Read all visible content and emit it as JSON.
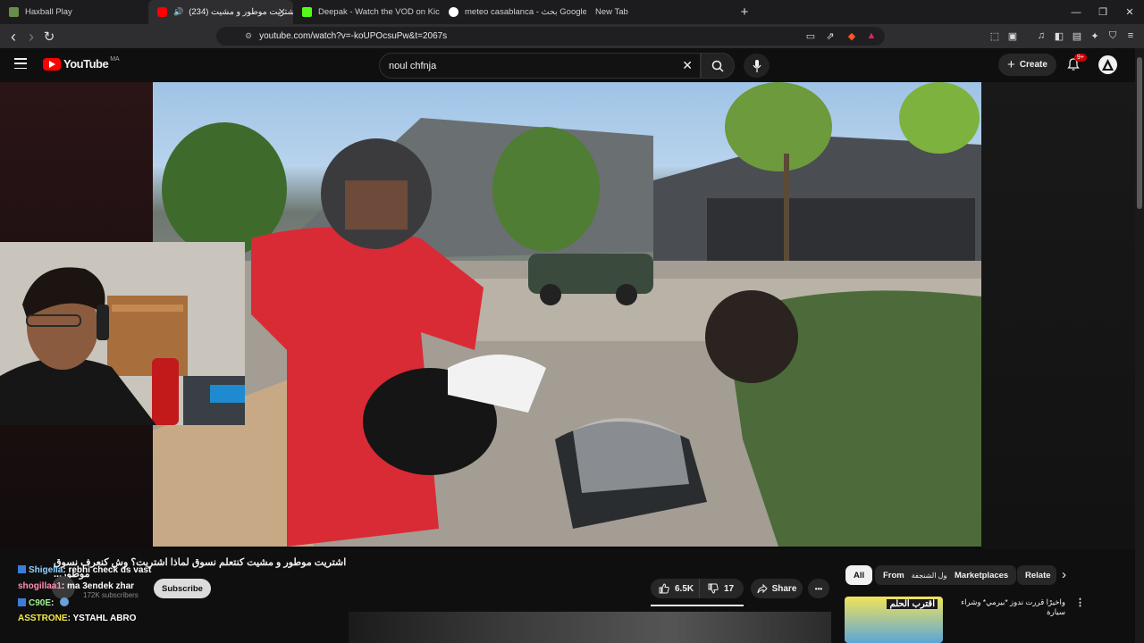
{
  "tabs": [
    {
      "title": "Haxball Play",
      "favicon_color": "#6a8c4a",
      "active": false
    },
    {
      "title": "(234) اشتريت موطور و مشيت",
      "favicon_color": "#ff0000",
      "active": true,
      "close": "✕"
    },
    {
      "title": "Deepak - Watch the VOD on Kick",
      "favicon_color": "#53fc18",
      "active": false
    },
    {
      "title": "meteo casablanca - بحث Google",
      "favicon_color": "#4285f4",
      "active": false
    },
    {
      "title": "New Tab",
      "favicon_color": "#2e2e31",
      "active": false
    }
  ],
  "browser": {
    "new_tab": "+",
    "minimize": "—",
    "restore": "❐",
    "close": "✕",
    "back": "‹",
    "forward": "›",
    "reload": "↻",
    "bookmark": "☆",
    "url": "youtube.com/watch?v=-koUPOcsuPw&t=2067s"
  },
  "youtube": {
    "logo_text": "YouTube",
    "region": "MA",
    "search_value": "noul chfnja",
    "clear": "✕",
    "create_label": "Create",
    "notifications_badge": "9+"
  },
  "video": {
    "title": "اشتريت موطور و مشيت كنتعلم نسوق لماذا اشتريت؟ وش كنعرف نسوق موطور...",
    "channel_subscribers": "172K subscribers",
    "subscribe_label": "Subscribe",
    "likes": "6.5K",
    "dislikes": "17",
    "share_label": "Share",
    "more": "•••"
  },
  "chat": [
    {
      "user": "Shigella",
      "message": ": rebhi check ds vast",
      "color": "#8fd3ff",
      "icon": true
    },
    {
      "user": "shogillaa1",
      "message": ": ma 3endek zhar",
      "color": "#ff8fb1",
      "icon": false
    },
    {
      "user": "C90E",
      "message": ":",
      "color": "#9ff58f",
      "icon": true
    },
    {
      "user": "ASSTRONE",
      "message": ": YSTAHL ABRO",
      "color": "#f5e84a",
      "icon": false
    }
  ],
  "related": {
    "chips": [
      "All",
      "From",
      "مول الشنجفة",
      "Marketplaces",
      "Relate"
    ],
    "next": "›",
    "item_title": "واخيرًا قررت ندوز *بيرمي* وشراء سيارة",
    "item_thumb_label": "اقترب الحلم"
  }
}
